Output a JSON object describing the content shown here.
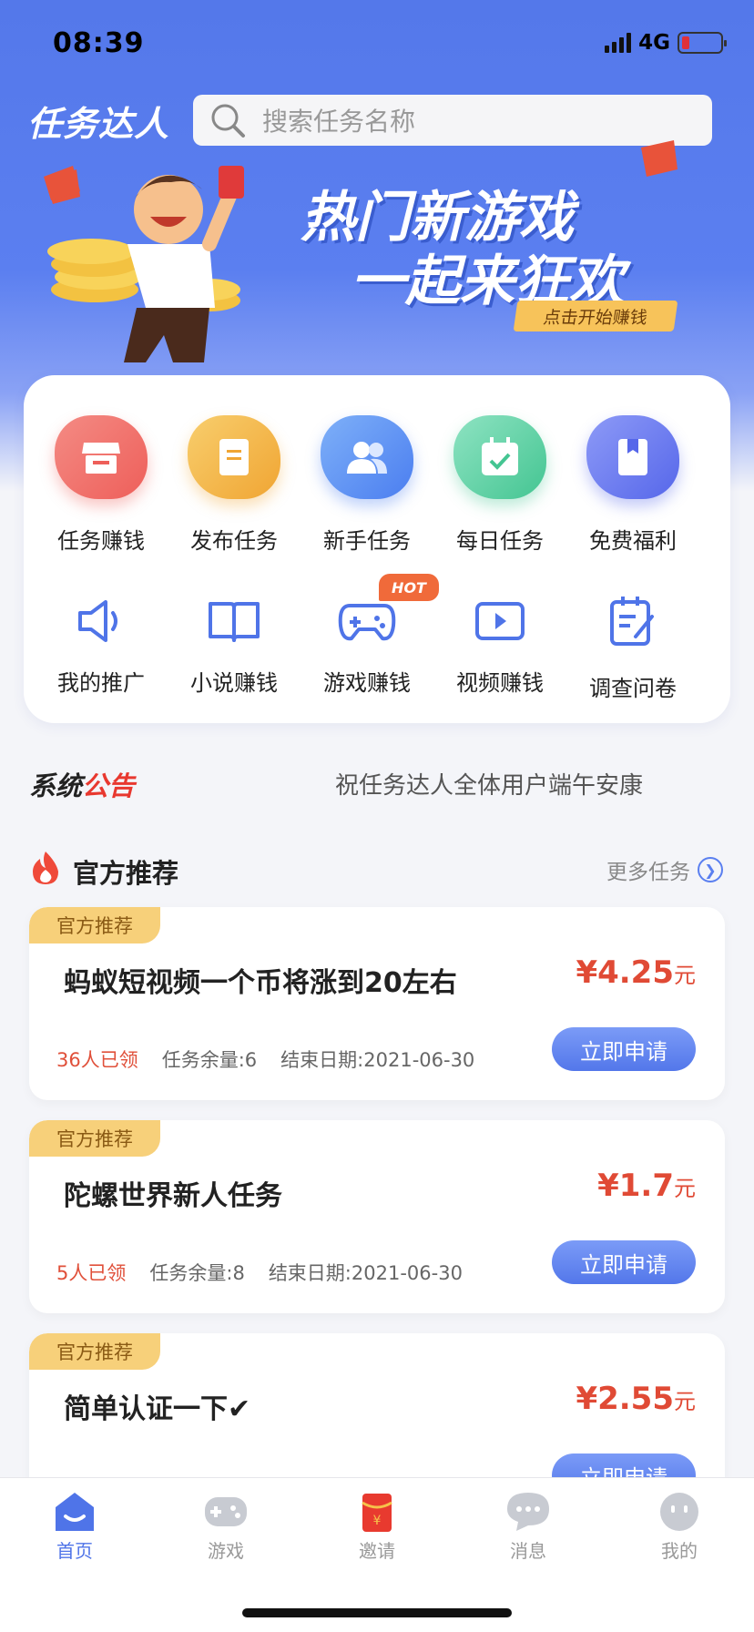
{
  "status": {
    "time": "08:39",
    "network": "4G"
  },
  "header": {
    "logo": "任务达人",
    "search_placeholder": "搜索任务名称"
  },
  "banner": {
    "line1": "热门新游戏",
    "line2": "一起来狂欢",
    "cta": "点击开始赚钱"
  },
  "grid": {
    "primary": [
      {
        "label": "任务赚钱",
        "icon": "store-icon",
        "color": "#f0706a"
      },
      {
        "label": "发布任务",
        "icon": "document-icon",
        "color": "#f3b34a"
      },
      {
        "label": "新手任务",
        "icon": "users-icon",
        "color": "#5c8ff2"
      },
      {
        "label": "每日任务",
        "icon": "calendar-check-icon",
        "color": "#5fd2a6"
      },
      {
        "label": "免费福利",
        "icon": "bookmark-icon",
        "color": "#6c7cf2"
      }
    ],
    "secondary": [
      {
        "label": "我的推广",
        "icon": "megaphone-icon"
      },
      {
        "label": "小说赚钱",
        "icon": "book-icon"
      },
      {
        "label": "游戏赚钱",
        "icon": "gamepad-icon",
        "badge": "HOT"
      },
      {
        "label": "视频赚钱",
        "icon": "video-play-icon"
      },
      {
        "label": "调查问卷",
        "icon": "survey-icon"
      }
    ]
  },
  "notice": {
    "title_a": "系统",
    "title_b": "公告",
    "text": "祝任务达人全体用户端午安康"
  },
  "recommend": {
    "title": "官方推荐",
    "more": "更多任务"
  },
  "tasks": [
    {
      "tag": "官方推荐",
      "name": "蚂蚁短视频一个币将涨到20左右",
      "price": "¥4.25",
      "unit": "元",
      "claimed": "36人已领",
      "remaining": "任务余量:6",
      "end": "结束日期:2021-06-30",
      "apply": "立即申请"
    },
    {
      "tag": "官方推荐",
      "name": "陀螺世界新人任务",
      "price": "¥1.7",
      "unit": "元",
      "claimed": "5人已领",
      "remaining": "任务余量:8",
      "end": "结束日期:2021-06-30",
      "apply": "立即申请"
    },
    {
      "tag": "官方推荐",
      "name": "简单认证一下✔",
      "price": "¥2.55",
      "unit": "元",
      "claimed": "",
      "remaining": "",
      "end": "",
      "apply": "立即申请"
    }
  ],
  "tabbar": [
    {
      "label": "首页",
      "icon": "home-icon",
      "active": true
    },
    {
      "label": "游戏",
      "icon": "gamepad-icon",
      "active": false
    },
    {
      "label": "邀请",
      "icon": "red-envelope-icon",
      "active": false
    },
    {
      "label": "消息",
      "icon": "message-icon",
      "active": false
    },
    {
      "label": "我的",
      "icon": "profile-icon",
      "active": false
    }
  ],
  "colors": {
    "accent": "#5377ea",
    "price": "#e04a35",
    "tag": "#f7d07a"
  }
}
